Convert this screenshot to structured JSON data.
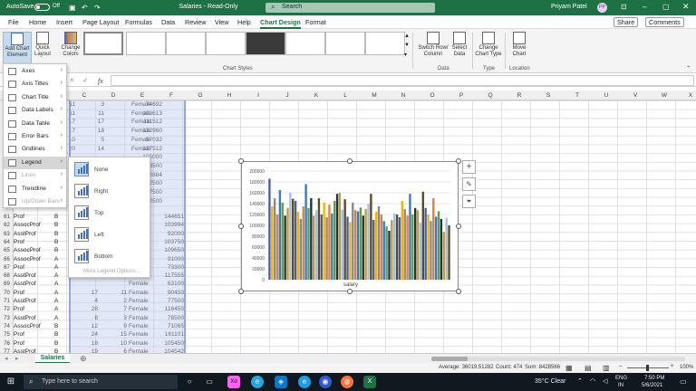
{
  "titlebar": {
    "autosave_label": "AutoSave",
    "toggle_state": "Off",
    "title": "Salaries - Read-Only",
    "search_placeholder": "Search",
    "user_name": "Priyam Patel",
    "user_initials": "PP"
  },
  "tabs": [
    "File",
    "Home",
    "Insert",
    "Page Layout",
    "Formulas",
    "Data",
    "Review",
    "View",
    "Help",
    "Chart Design",
    "Format"
  ],
  "active_tab": "Chart Design",
  "share_label": "Share",
  "comments_label": "Comments",
  "ribbon": {
    "add_chart_element": [
      "Add Chart",
      "Element"
    ],
    "quick_layout": [
      "Quick",
      "Layout"
    ],
    "change_colors": [
      "Change",
      "Colors"
    ],
    "chart_styles_group": "Chart Styles",
    "switch_row_col": [
      "Switch Row/",
      "Column"
    ],
    "select_data": [
      "Select",
      "Data"
    ],
    "data_group": "Data",
    "change_chart_type": [
      "Change",
      "Chart Type"
    ],
    "type_group": "Type",
    "move_chart": [
      "Move",
      "Chart"
    ],
    "location_group": "Location"
  },
  "formula_bar": {
    "fx": "fx",
    "cancel": "×",
    "enter": "✓"
  },
  "columns": [
    "C",
    "D",
    "E",
    "F",
    "G",
    "H",
    "I",
    "J",
    "K",
    "L",
    "M",
    "N",
    "O",
    "P",
    "Q",
    "R",
    "S",
    "T",
    "U",
    "V",
    "W",
    "X"
  ],
  "rows_top": [
    [
      "",
      "11",
      "3",
      "Female",
      "74692"
    ],
    [
      "",
      "11",
      "11",
      "Female",
      "103613"
    ],
    [
      "",
      "17",
      "17",
      "Female",
      "111512"
    ],
    [
      "",
      "17",
      "18",
      "Female",
      "122960"
    ],
    [
      "",
      "10",
      "5",
      "Female",
      "97032"
    ],
    [
      "",
      "20",
      "14",
      "Female",
      "127512"
    ],
    [
      "",
      "",
      "",
      "",
      "105000"
    ],
    [
      "",
      "",
      "",
      "",
      "73500"
    ],
    [
      "",
      "",
      "",
      "",
      "62884"
    ],
    [
      "",
      "",
      "",
      "",
      "72500"
    ],
    [
      "",
      "",
      "",
      "",
      "77500"
    ],
    [
      "",
      "",
      "",
      "",
      "72500"
    ]
  ],
  "rows_bottom": [
    {
      "n": "61",
      "a": "Prof",
      "b": "B",
      "c": "",
      "d": "",
      "e": "",
      "f": "144651"
    },
    {
      "n": "62",
      "a": "AssocProf",
      "b": "B",
      "c": "",
      "d": "",
      "e": "",
      "f": "103994"
    },
    {
      "n": "63",
      "a": "AsstProf",
      "b": "B",
      "c": "",
      "d": "",
      "e": "",
      "f": "92000"
    },
    {
      "n": "64",
      "a": "Prof",
      "b": "B",
      "c": "",
      "d": "",
      "e": "",
      "f": "103750"
    },
    {
      "n": "65",
      "a": "AssocProf",
      "b": "B",
      "c": "",
      "d": "",
      "e": "",
      "f": "109650"
    },
    {
      "n": "66",
      "a": "AssocProf",
      "b": "A",
      "c": "",
      "d": "",
      "e": "",
      "f": "91000"
    },
    {
      "n": "67",
      "a": "Prof",
      "b": "A",
      "c": "",
      "d": "",
      "e": "",
      "f": "73300"
    },
    {
      "n": "68",
      "a": "AsstProf",
      "b": "A",
      "c": "",
      "d": "",
      "e": "",
      "f": "117555"
    },
    {
      "n": "69",
      "a": "AsstProf",
      "b": "A",
      "c": "",
      "d": "",
      "e": "Female",
      "f": "63100"
    },
    {
      "n": "70",
      "a": "Prof",
      "b": "A",
      "c": "17",
      "d": "11",
      "e": "Female",
      "f": "90450"
    },
    {
      "n": "71",
      "a": "AsstProf",
      "b": "A",
      "c": "4",
      "d": "2",
      "e": "Female",
      "f": "77500"
    },
    {
      "n": "72",
      "a": "Prof",
      "b": "A",
      "c": "28",
      "d": "7",
      "e": "Female",
      "f": "116450"
    },
    {
      "n": "73",
      "a": "AsstProf",
      "b": "A",
      "c": "8",
      "d": "3",
      "e": "Female",
      "f": "78500"
    },
    {
      "n": "74",
      "a": "AssocProf",
      "b": "B",
      "c": "12",
      "d": "9",
      "e": "Female",
      "f": "71065"
    },
    {
      "n": "75",
      "a": "Prof",
      "b": "B",
      "c": "24",
      "d": "15",
      "e": "Female",
      "f": "161101"
    },
    {
      "n": "76",
      "a": "Prof",
      "b": "B",
      "c": "18",
      "d": "10",
      "e": "Female",
      "f": "105450"
    },
    {
      "n": "77",
      "a": "AsstProf",
      "b": "B",
      "c": "19",
      "d": "6",
      "e": "Female",
      "f": "104542"
    }
  ],
  "menu_add_chart_element": [
    {
      "label": "Axes",
      "disabled": false,
      "hover": false
    },
    {
      "label": "Axis Titles",
      "disabled": false,
      "hover": false
    },
    {
      "label": "Chart Title",
      "disabled": false,
      "hover": false
    },
    {
      "label": "Data Labels",
      "disabled": false,
      "hover": false
    },
    {
      "label": "Data Table",
      "disabled": false,
      "hover": false
    },
    {
      "label": "Error Bars",
      "disabled": false,
      "hover": false
    },
    {
      "label": "Gridlines",
      "disabled": false,
      "hover": false
    },
    {
      "label": "Legend",
      "disabled": false,
      "hover": true
    },
    {
      "label": "Lines",
      "disabled": true,
      "hover": false
    },
    {
      "label": "Trendline",
      "disabled": false,
      "hover": false
    },
    {
      "label": "Up/Down Bars",
      "disabled": true,
      "hover": false
    }
  ],
  "menu_legend": [
    {
      "label": "None",
      "selected": true
    },
    {
      "label": "Right",
      "selected": false
    },
    {
      "label": "Top",
      "selected": false
    },
    {
      "label": "Left",
      "selected": false
    },
    {
      "label": "Bottom",
      "selected": false
    }
  ],
  "menu_legend_more": "More Legend Options...",
  "chart_data": {
    "type": "bar",
    "xlabel": "salary",
    "ylim": [
      0,
      200000
    ],
    "yticks": [
      "200000",
      "180000",
      "160000",
      "140000",
      "120000",
      "100000",
      "80000",
      "60000",
      "40000",
      "20000",
      "0"
    ],
    "values": [
      186000,
      135000,
      150000,
      120000,
      165000,
      142000,
      118000,
      132000,
      160000,
      149000,
      145000,
      125000,
      112000,
      135000,
      176000,
      132000,
      150000,
      118000,
      128000,
      150000,
      120000,
      142000,
      115000,
      138000,
      122000,
      145000,
      158000,
      160000,
      129000,
      148000,
      116000,
      106000,
      142000,
      128000,
      126000,
      133000,
      118000,
      130000,
      140000,
      158000,
      110000,
      125000,
      135000,
      120000,
      108000,
      98000,
      90000,
      110000,
      122000,
      120000,
      115000,
      145000,
      130000,
      118000,
      158000,
      120000,
      132000,
      128000,
      105000,
      162000,
      132000,
      120000,
      108000,
      150000,
      116000,
      126000,
      112000,
      88000,
      114000,
      100000
    ]
  },
  "sheet_tab": "Salaries",
  "status": {
    "average": "Average: 36019.51282",
    "count": "Count: 474",
    "sum": "Sum: 8428566",
    "zoom": "100%"
  },
  "taskbar": {
    "search": "Type here to search",
    "weather": "35°C Clear",
    "lang": "ENG",
    "region": "IN",
    "time": "7:50 PM",
    "date": "5/6/2021"
  },
  "colors": {
    "excel_green": "#1e7145",
    "bar_palette": [
      "#4a5ea8",
      "#f0b400",
      "#8a8a8a",
      "#e0803a",
      "#3a7ac0",
      "#59a14f",
      "#24304a",
      "#c49a3a",
      "#9cc3e5",
      "#5a4a2a"
    ]
  }
}
